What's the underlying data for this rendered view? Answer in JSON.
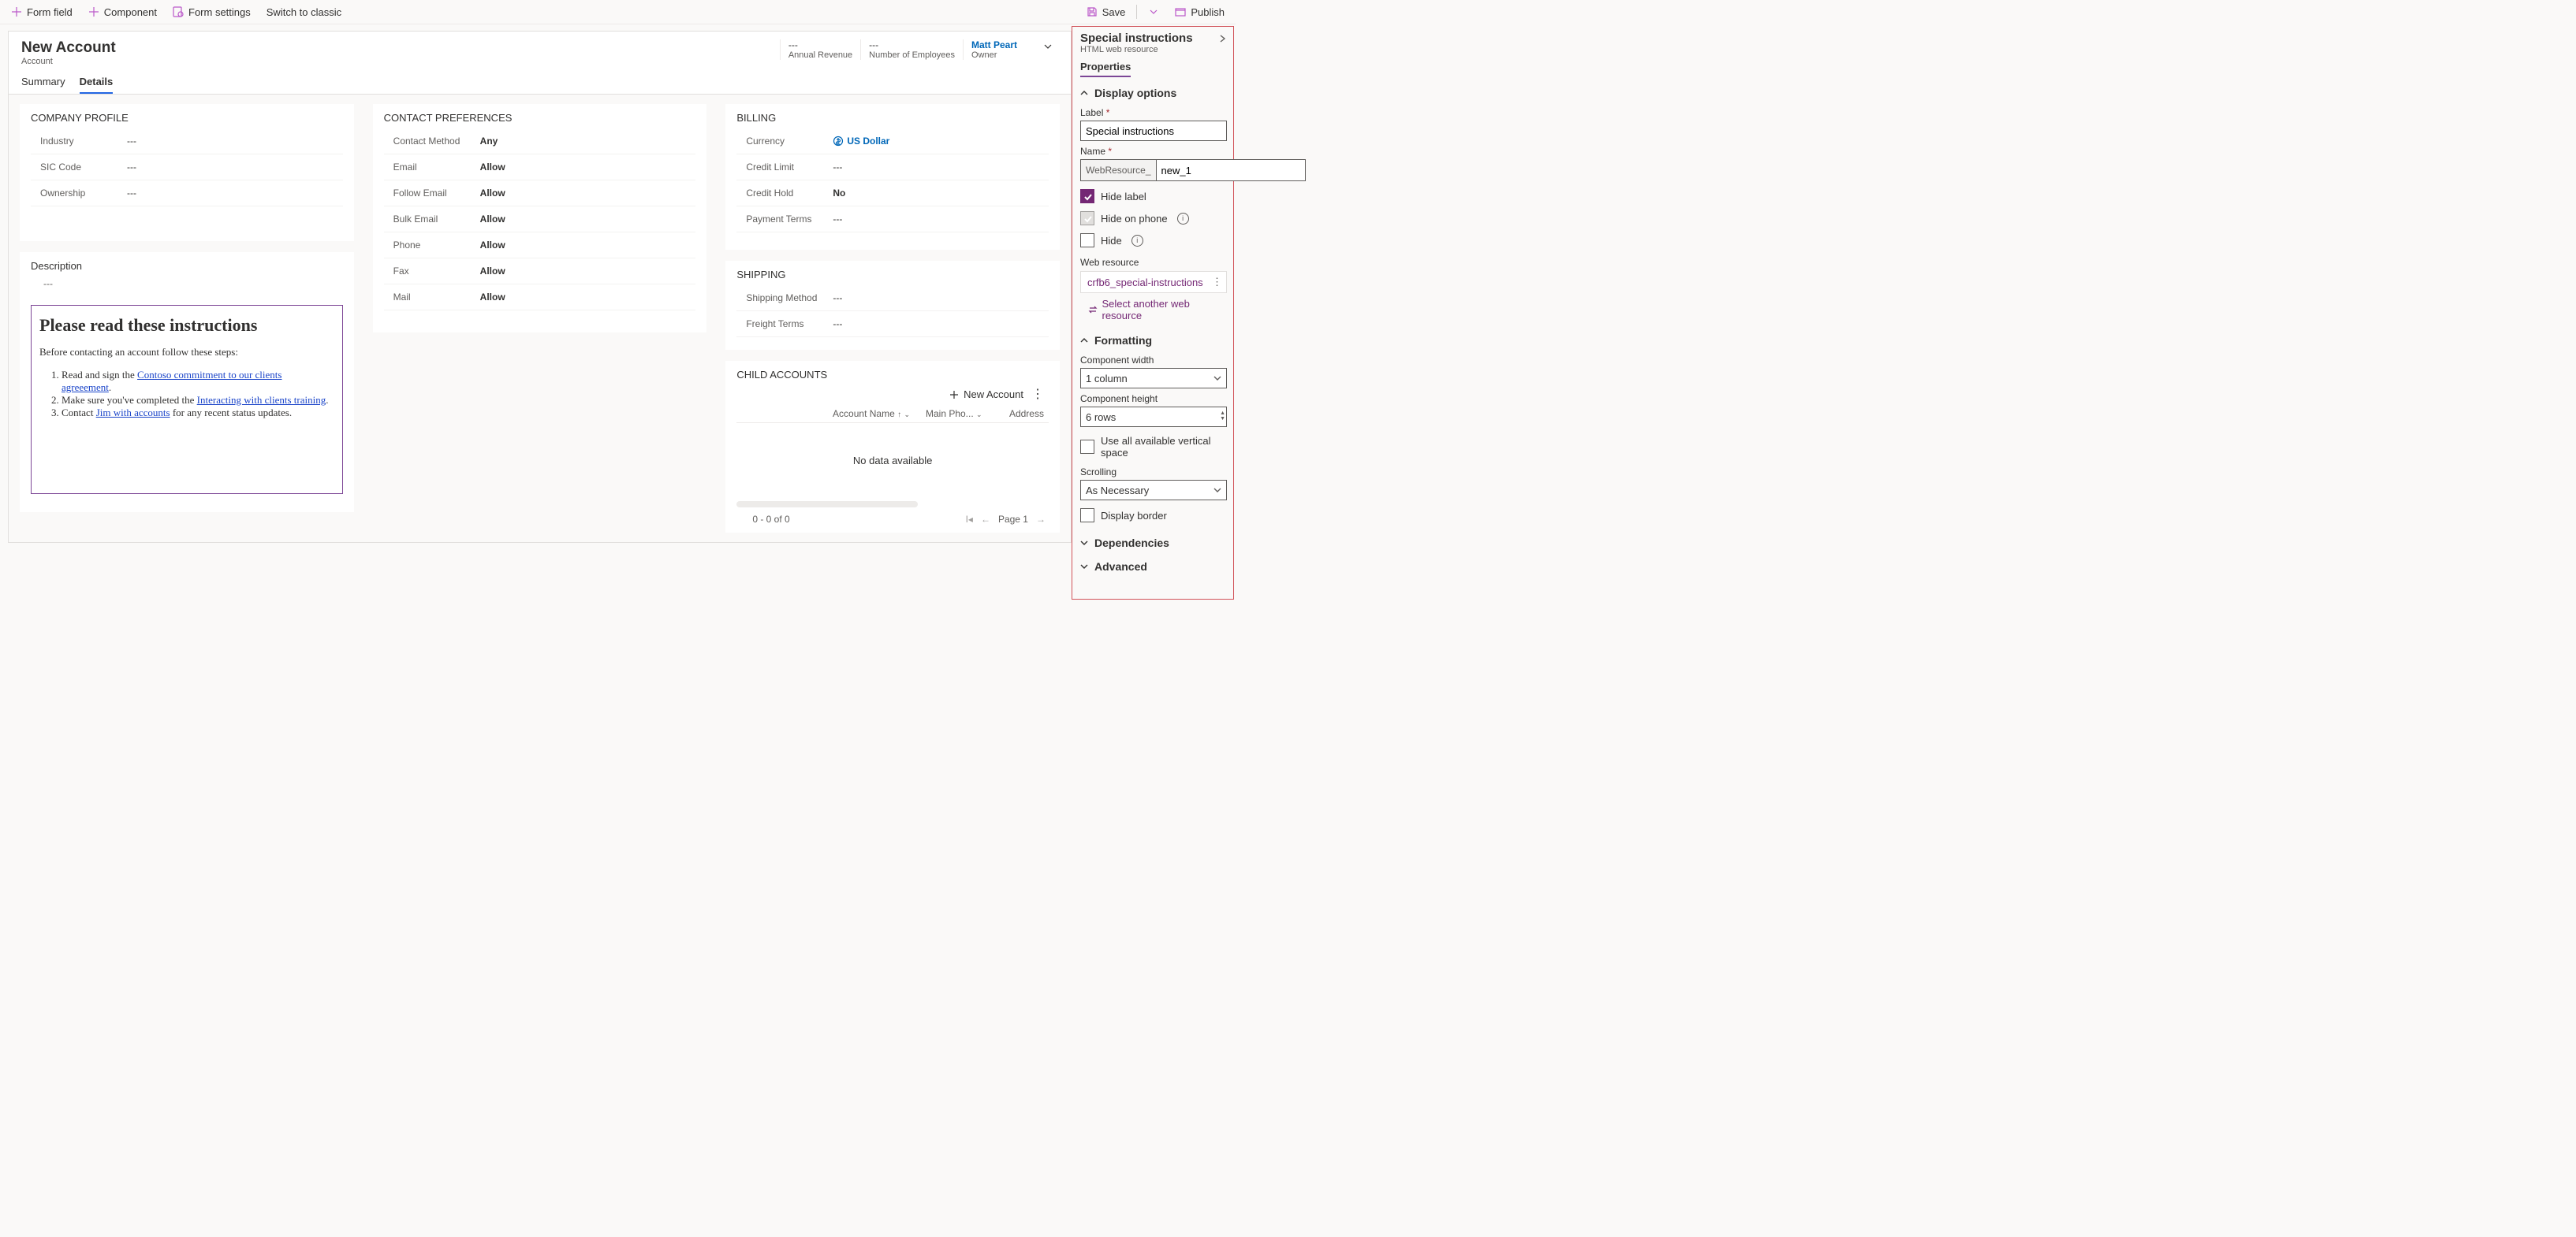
{
  "cmd": {
    "formField": "Form field",
    "component": "Component",
    "formSettings": "Form settings",
    "switch": "Switch to classic",
    "save": "Save",
    "publish": "Publish"
  },
  "form": {
    "title": "New Account",
    "entity": "Account",
    "hdr": {
      "rev_v": "---",
      "rev_l": "Annual Revenue",
      "emp_v": "---",
      "emp_l": "Number of Employees",
      "own_v": "Matt Peart",
      "own_l": "Owner"
    },
    "tabs": {
      "summary": "Summary",
      "details": "Details"
    }
  },
  "company": {
    "title": "COMPANY PROFILE",
    "industry": {
      "l": "Industry",
      "v": "---"
    },
    "sic": {
      "l": "SIC Code",
      "v": "---"
    },
    "own": {
      "l": "Ownership",
      "v": "---"
    }
  },
  "desc": {
    "l": "Description",
    "v": "---"
  },
  "wr": {
    "heading": "Please read these instructions",
    "intro": "Before contacting an account follow these steps:",
    "li1a": "Read and sign the ",
    "li1link": "Contoso commitment to our clients agreeement",
    "li1b": ".",
    "li2a": "Make sure you've completed the ",
    "li2link": "Interacting with clients training",
    "li2b": ".",
    "li3a": "Contact ",
    "li3link": "Jim with accounts",
    "li3b": " for any recent status updates."
  },
  "contact": {
    "title": "CONTACT PREFERENCES",
    "cm": {
      "l": "Contact Method",
      "v": "Any"
    },
    "em": {
      "l": "Email",
      "v": "Allow"
    },
    "fe": {
      "l": "Follow Email",
      "v": "Allow"
    },
    "be": {
      "l": "Bulk Email",
      "v": "Allow"
    },
    "ph": {
      "l": "Phone",
      "v": "Allow"
    },
    "fx": {
      "l": "Fax",
      "v": "Allow"
    },
    "ml": {
      "l": "Mail",
      "v": "Allow"
    }
  },
  "billing": {
    "title": "BILLING",
    "cur": {
      "l": "Currency",
      "v": "US Dollar"
    },
    "cl": {
      "l": "Credit Limit",
      "v": "---"
    },
    "ch": {
      "l": "Credit Hold",
      "v": "No"
    },
    "pt": {
      "l": "Payment Terms",
      "v": "---"
    }
  },
  "shipping": {
    "title": "SHIPPING",
    "sm": {
      "l": "Shipping Method",
      "v": "---"
    },
    "ft": {
      "l": "Freight Terms",
      "v": "---"
    }
  },
  "child": {
    "title": "CHILD ACCOUNTS",
    "new": "New Account",
    "col1": "Account Name",
    "col2": "Main Pho...",
    "col3": "Address",
    "empty": "No data available",
    "range": "0 - 0 of 0",
    "page": "Page 1"
  },
  "pp": {
    "title": "Special instructions",
    "sub": "HTML web resource",
    "tab": "Properties",
    "displayOptions": "Display options",
    "label": "Label",
    "labelVal": "Special instructions",
    "name": "Name",
    "namePrefix": "WebResource_",
    "nameVal": "new_1",
    "hideLabel": "Hide label",
    "hidePhone": "Hide on phone",
    "hide": "Hide",
    "webResource": "Web resource",
    "webResourceVal": "crfb6_special-instructions",
    "selectAnother": "Select another web resource",
    "formatting": "Formatting",
    "compWidth": "Component width",
    "compWidthVal": "1 column",
    "compHeight": "Component height",
    "compHeightVal": "6 rows",
    "useAll": "Use all available vertical space",
    "scrolling": "Scrolling",
    "scrollingVal": "As Necessary",
    "displayBorder": "Display border",
    "deps": "Dependencies",
    "adv": "Advanced"
  }
}
